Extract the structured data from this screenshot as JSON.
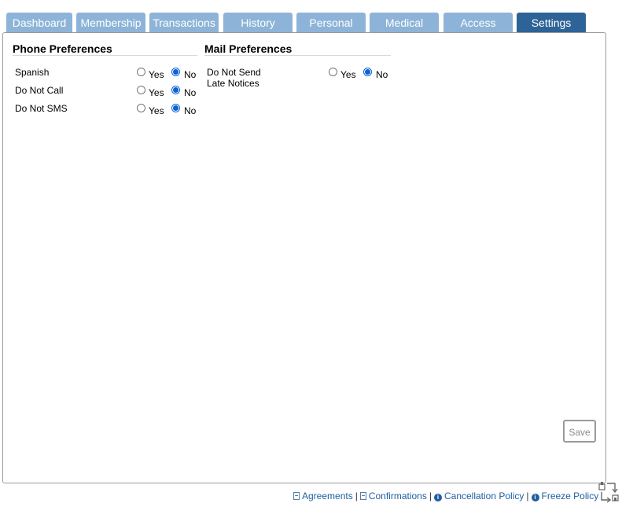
{
  "tabs": [
    {
      "label": "Dashboard",
      "active": false
    },
    {
      "label": "Membership",
      "active": false
    },
    {
      "label": "Transactions",
      "active": false
    },
    {
      "label": "History",
      "active": false
    },
    {
      "label": "Personal",
      "active": false
    },
    {
      "label": "Medical",
      "active": false
    },
    {
      "label": "Access",
      "active": false
    },
    {
      "label": "Settings",
      "active": true
    }
  ],
  "phone": {
    "title": "Phone Preferences",
    "yes_label": "Yes",
    "no_label": "No",
    "items": [
      {
        "label": "Spanish",
        "value": "No"
      },
      {
        "label": "Do Not Call",
        "value": "No"
      },
      {
        "label": "Do Not SMS",
        "value": "No"
      }
    ]
  },
  "mail": {
    "title": "Mail Preferences",
    "yes_label": "Yes",
    "no_label": "No",
    "items": [
      {
        "label_line1": "Do Not Send",
        "label_line2": "Late Notices",
        "value": "No"
      }
    ]
  },
  "save_label": "Save",
  "footer": {
    "agreements": "Agreements",
    "confirmations": "Confirmations",
    "cancellation": "Cancellation Policy",
    "freeze": "Freeze Policy",
    "separator": "|"
  },
  "colors": {
    "tab": "#8db4d8",
    "tab_active": "#2e6398",
    "radio_checked": "#0a62d6",
    "link": "#1f5fa0"
  },
  "icons": {
    "agreements": "pdf-file-icon",
    "confirmations": "pdf-file-icon",
    "cancellation": "info-circle-icon",
    "freeze": "info-circle-icon",
    "resize": "resize-icon"
  }
}
